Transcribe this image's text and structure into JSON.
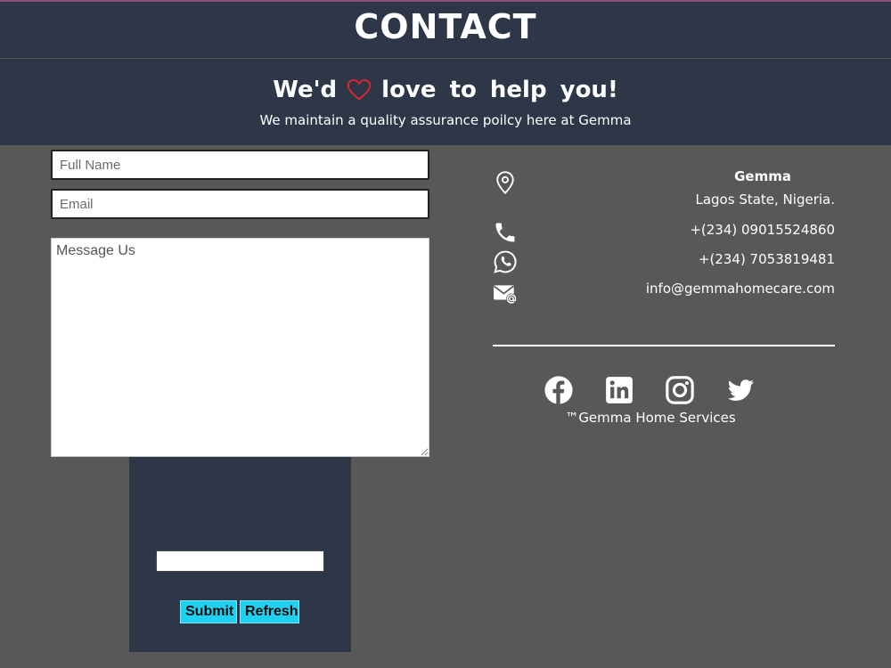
{
  "header": {
    "title": "CONTACT"
  },
  "hero": {
    "tagline_before": "We'd",
    "tagline_after": "love to help you!",
    "heart_icon": "heart-outline-icon",
    "heart_color": "#e0262f",
    "subtitle": "We maintain a quality assurance poilcy here at Gemma"
  },
  "form": {
    "name_placeholder": "Full Name",
    "email_placeholder": "Email",
    "message_placeholder": "Message Us",
    "submit_label": "Submit",
    "refresh_label": "Refresh"
  },
  "contact": {
    "company": "Gemma",
    "address": "Lagos State, Nigeria.",
    "phone": "+(234) 09015524860",
    "whatsapp": "+(234) 7053819481",
    "email": "info@gemmahomecare.com"
  },
  "social": {
    "icons": [
      "facebook-icon",
      "linkedin-icon",
      "instagram-icon",
      "twitter-icon"
    ]
  },
  "footer": {
    "text": "™Gemma Home Services"
  },
  "colors": {
    "header_bg": "#2d3748",
    "page_bg": "#585858",
    "button_bg": "#1fd1ef"
  }
}
